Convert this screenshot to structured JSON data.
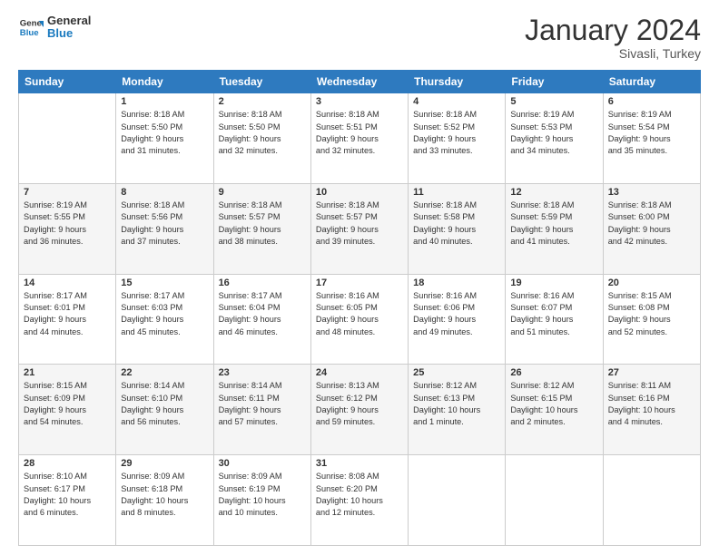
{
  "logo": {
    "line1": "General",
    "line2": "Blue"
  },
  "title": "January 2024",
  "location": "Sivasli, Turkey",
  "header_days": [
    "Sunday",
    "Monday",
    "Tuesday",
    "Wednesday",
    "Thursday",
    "Friday",
    "Saturday"
  ],
  "weeks": [
    [
      {
        "day": "",
        "info": ""
      },
      {
        "day": "1",
        "info": "Sunrise: 8:18 AM\nSunset: 5:50 PM\nDaylight: 9 hours\nand 31 minutes."
      },
      {
        "day": "2",
        "info": "Sunrise: 8:18 AM\nSunset: 5:50 PM\nDaylight: 9 hours\nand 32 minutes."
      },
      {
        "day": "3",
        "info": "Sunrise: 8:18 AM\nSunset: 5:51 PM\nDaylight: 9 hours\nand 32 minutes."
      },
      {
        "day": "4",
        "info": "Sunrise: 8:18 AM\nSunset: 5:52 PM\nDaylight: 9 hours\nand 33 minutes."
      },
      {
        "day": "5",
        "info": "Sunrise: 8:19 AM\nSunset: 5:53 PM\nDaylight: 9 hours\nand 34 minutes."
      },
      {
        "day": "6",
        "info": "Sunrise: 8:19 AM\nSunset: 5:54 PM\nDaylight: 9 hours\nand 35 minutes."
      }
    ],
    [
      {
        "day": "7",
        "info": "Sunrise: 8:19 AM\nSunset: 5:55 PM\nDaylight: 9 hours\nand 36 minutes."
      },
      {
        "day": "8",
        "info": "Sunrise: 8:18 AM\nSunset: 5:56 PM\nDaylight: 9 hours\nand 37 minutes."
      },
      {
        "day": "9",
        "info": "Sunrise: 8:18 AM\nSunset: 5:57 PM\nDaylight: 9 hours\nand 38 minutes."
      },
      {
        "day": "10",
        "info": "Sunrise: 8:18 AM\nSunset: 5:57 PM\nDaylight: 9 hours\nand 39 minutes."
      },
      {
        "day": "11",
        "info": "Sunrise: 8:18 AM\nSunset: 5:58 PM\nDaylight: 9 hours\nand 40 minutes."
      },
      {
        "day": "12",
        "info": "Sunrise: 8:18 AM\nSunset: 5:59 PM\nDaylight: 9 hours\nand 41 minutes."
      },
      {
        "day": "13",
        "info": "Sunrise: 8:18 AM\nSunset: 6:00 PM\nDaylight: 9 hours\nand 42 minutes."
      }
    ],
    [
      {
        "day": "14",
        "info": "Sunrise: 8:17 AM\nSunset: 6:01 PM\nDaylight: 9 hours\nand 44 minutes."
      },
      {
        "day": "15",
        "info": "Sunrise: 8:17 AM\nSunset: 6:03 PM\nDaylight: 9 hours\nand 45 minutes."
      },
      {
        "day": "16",
        "info": "Sunrise: 8:17 AM\nSunset: 6:04 PM\nDaylight: 9 hours\nand 46 minutes."
      },
      {
        "day": "17",
        "info": "Sunrise: 8:16 AM\nSunset: 6:05 PM\nDaylight: 9 hours\nand 48 minutes."
      },
      {
        "day": "18",
        "info": "Sunrise: 8:16 AM\nSunset: 6:06 PM\nDaylight: 9 hours\nand 49 minutes."
      },
      {
        "day": "19",
        "info": "Sunrise: 8:16 AM\nSunset: 6:07 PM\nDaylight: 9 hours\nand 51 minutes."
      },
      {
        "day": "20",
        "info": "Sunrise: 8:15 AM\nSunset: 6:08 PM\nDaylight: 9 hours\nand 52 minutes."
      }
    ],
    [
      {
        "day": "21",
        "info": "Sunrise: 8:15 AM\nSunset: 6:09 PM\nDaylight: 9 hours\nand 54 minutes."
      },
      {
        "day": "22",
        "info": "Sunrise: 8:14 AM\nSunset: 6:10 PM\nDaylight: 9 hours\nand 56 minutes."
      },
      {
        "day": "23",
        "info": "Sunrise: 8:14 AM\nSunset: 6:11 PM\nDaylight: 9 hours\nand 57 minutes."
      },
      {
        "day": "24",
        "info": "Sunrise: 8:13 AM\nSunset: 6:12 PM\nDaylight: 9 hours\nand 59 minutes."
      },
      {
        "day": "25",
        "info": "Sunrise: 8:12 AM\nSunset: 6:13 PM\nDaylight: 10 hours\nand 1 minute."
      },
      {
        "day": "26",
        "info": "Sunrise: 8:12 AM\nSunset: 6:15 PM\nDaylight: 10 hours\nand 2 minutes."
      },
      {
        "day": "27",
        "info": "Sunrise: 8:11 AM\nSunset: 6:16 PM\nDaylight: 10 hours\nand 4 minutes."
      }
    ],
    [
      {
        "day": "28",
        "info": "Sunrise: 8:10 AM\nSunset: 6:17 PM\nDaylight: 10 hours\nand 6 minutes."
      },
      {
        "day": "29",
        "info": "Sunrise: 8:09 AM\nSunset: 6:18 PM\nDaylight: 10 hours\nand 8 minutes."
      },
      {
        "day": "30",
        "info": "Sunrise: 8:09 AM\nSunset: 6:19 PM\nDaylight: 10 hours\nand 10 minutes."
      },
      {
        "day": "31",
        "info": "Sunrise: 8:08 AM\nSunset: 6:20 PM\nDaylight: 10 hours\nand 12 minutes."
      },
      {
        "day": "",
        "info": ""
      },
      {
        "day": "",
        "info": ""
      },
      {
        "day": "",
        "info": ""
      }
    ]
  ]
}
